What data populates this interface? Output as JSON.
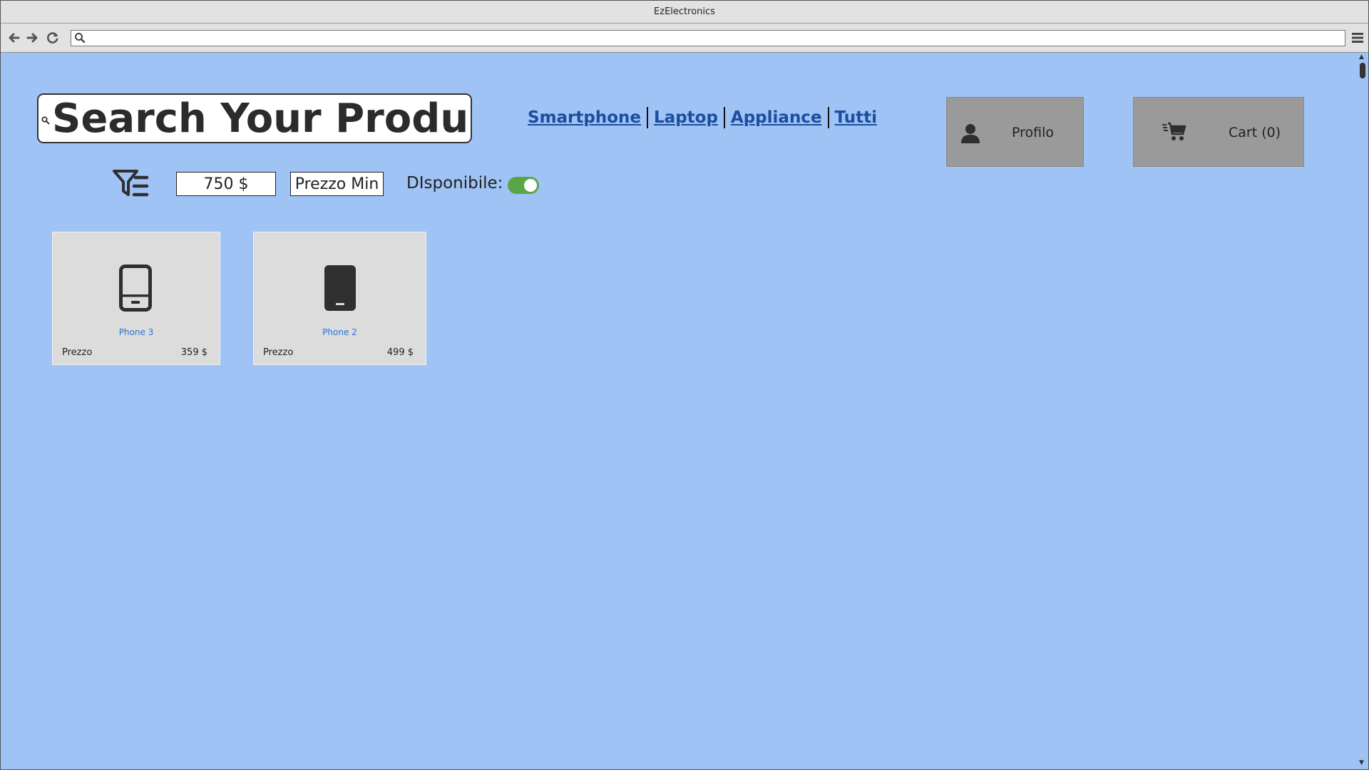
{
  "window": {
    "title": "EzElectronics"
  },
  "browser": {
    "url": "",
    "icons": [
      "back-arrow-icon",
      "forward-arrow-icon",
      "reload-icon",
      "search-icon",
      "hamburger-menu-icon"
    ]
  },
  "search": {
    "placeholder": "Search Your Product"
  },
  "categories": [
    "Smartphone",
    "Laptop",
    "Appliance",
    "Tutti"
  ],
  "profile_button": {
    "label": "Profilo",
    "icon": "person-icon"
  },
  "cart_button": {
    "label": "Cart (0)",
    "icon": "shopping-cart-icon"
  },
  "filters": {
    "icon": "filter-list-icon",
    "max_price_value": "750 $",
    "min_price_placeholder": "Prezzo Min",
    "available_label": "DIsponibile:",
    "available_on": true
  },
  "products": [
    {
      "name": "Phone 3",
      "price_label": "Prezzo",
      "price": "359 $",
      "icon": "smartphone-outline-icon"
    },
    {
      "name": "Phone 2",
      "price_label": "Prezzo",
      "price": "499 $",
      "icon": "smartphone-filled-icon"
    }
  ],
  "colors": {
    "page_background": "#9fc3f5",
    "tile_button": "#9a9a9a",
    "card_background": "#dcdcdc",
    "product_name": "#2a72d6",
    "toggle_on": "#5aa647",
    "category_link": "#1a4e9e"
  }
}
